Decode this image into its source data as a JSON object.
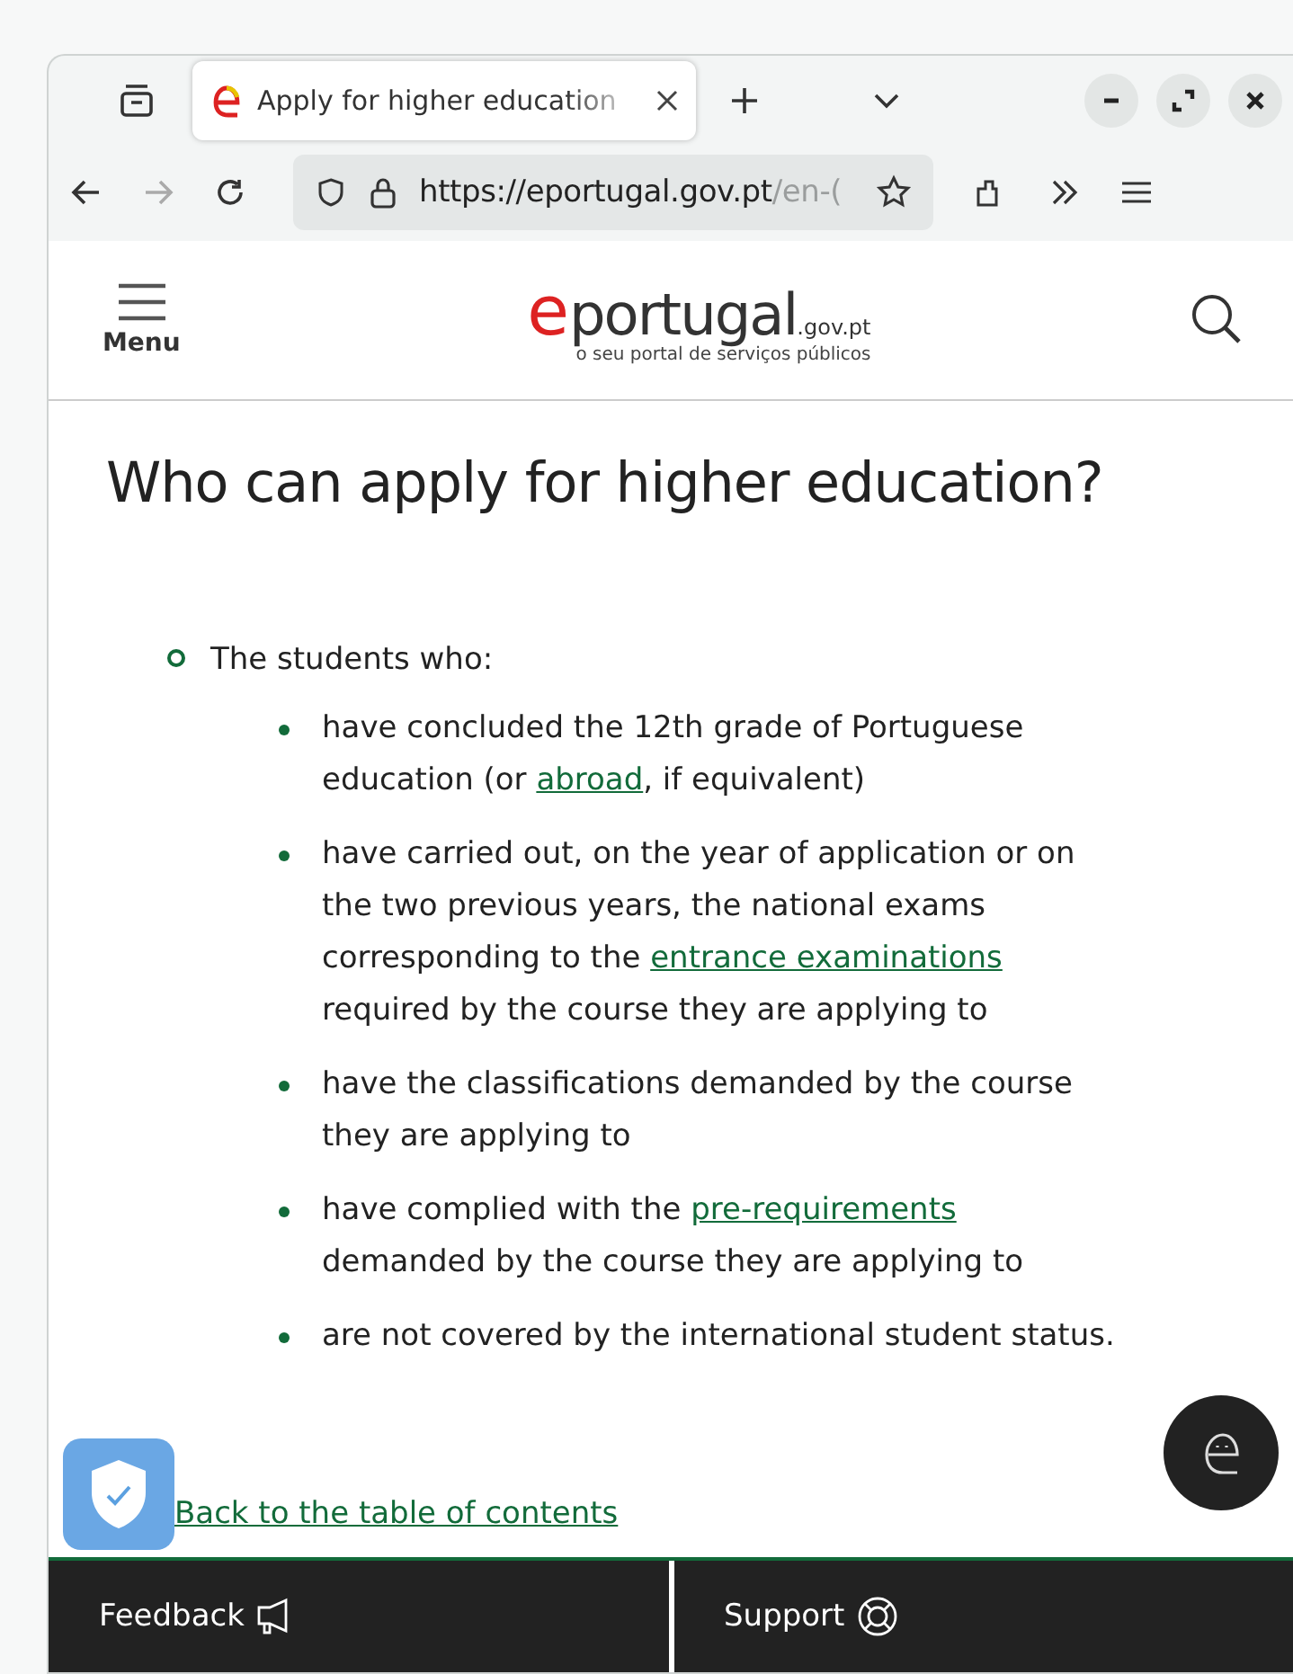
{
  "browser": {
    "tab": {
      "title": "Apply for higher education",
      "selected": true
    },
    "url": {
      "host": "https://eportugal.gov.pt",
      "rest": "/en-("
    }
  },
  "header": {
    "menu_label": "Menu",
    "logo": {
      "e": "e",
      "name": "portugal",
      "suffix": ".gov.pt",
      "tagline": "o seu portal de serviços públicos"
    }
  },
  "title": "Who can apply for higher education?",
  "list": {
    "label": "The students who:",
    "items": [
      {
        "parts": [
          {
            "text": "have concluded the 12th grade of Portuguese education (or ",
            "link": false
          },
          {
            "text": "abroad",
            "link": true
          },
          {
            "text": ", if equivalent)",
            "link": false
          }
        ]
      },
      {
        "parts": [
          {
            "text": "have carried out, on the year of application or on the two previous years, the national exams corresponding to the ",
            "link": false
          },
          {
            "text": "entrance examinations",
            "link": true
          },
          {
            "text": " required by the course they are applying to",
            "link": false
          }
        ]
      },
      {
        "parts": [
          {
            "text": "have the classifications demanded by the course they are applying to",
            "link": false
          }
        ]
      },
      {
        "parts": [
          {
            "text": "have complied with the ",
            "link": false
          },
          {
            "text": "pre-requirements",
            "link": true
          },
          {
            "text": " demanded by the course they are applying to",
            "link": false
          }
        ]
      },
      {
        "parts": [
          {
            "text": "are not covered by the international student status.",
            "link": false
          }
        ]
      }
    ]
  },
  "back_link": "Back to the table of contents",
  "footer": [
    {
      "label": "Feedback",
      "kind": "feedback"
    },
    {
      "label": "Support",
      "kind": "support"
    }
  ]
}
